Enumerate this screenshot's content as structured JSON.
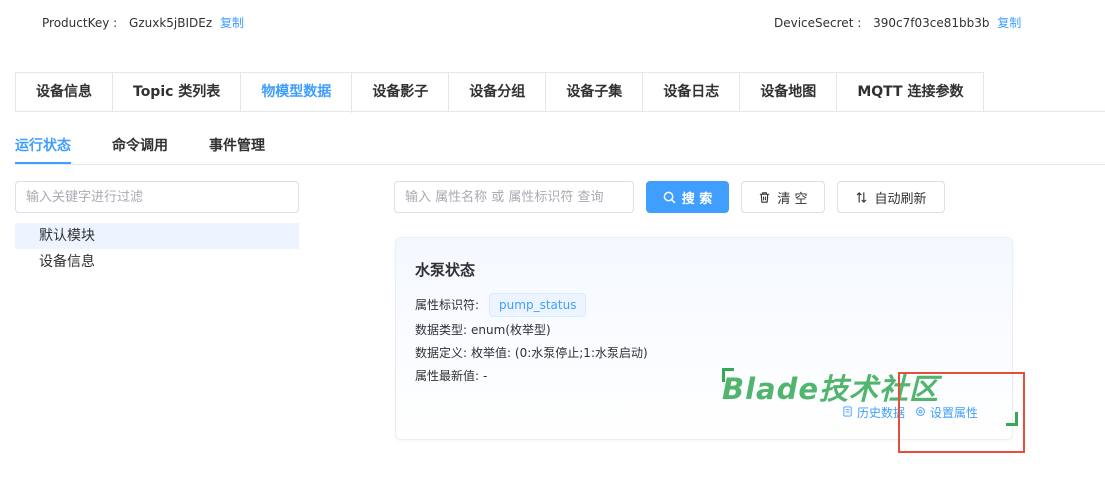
{
  "header": {
    "product_key_label": "ProductKey :",
    "product_key_value": "Gzuxk5jBIDEz",
    "product_key_copy": "复制",
    "device_secret_label": "DeviceSecret :",
    "device_secret_value": "390c7f03ce81bb3b",
    "device_secret_copy": "复制"
  },
  "tabs": [
    {
      "label": "设备信息",
      "active": false
    },
    {
      "label": "Topic 类列表",
      "active": false
    },
    {
      "label": "物模型数据",
      "active": true
    },
    {
      "label": "设备影子",
      "active": false
    },
    {
      "label": "设备分组",
      "active": false
    },
    {
      "label": "设备子集",
      "active": false
    },
    {
      "label": "设备日志",
      "active": false
    },
    {
      "label": "设备地图",
      "active": false
    },
    {
      "label": "MQTT 连接参数",
      "active": false
    }
  ],
  "subtabs": [
    {
      "label": "运行状态",
      "active": true
    },
    {
      "label": "命令调用",
      "active": false
    },
    {
      "label": "事件管理",
      "active": false
    }
  ],
  "sidebar": {
    "filter_placeholder": "输入关键字进行过滤",
    "tree": [
      {
        "label": "默认模块",
        "selected": true
      },
      {
        "label": "设备信息",
        "selected": false
      }
    ]
  },
  "toolbar": {
    "search_placeholder": "输入 属性名称 或 属性标识符 查询",
    "search_label": "搜 索",
    "clear_label": "清 空",
    "refresh_label": "自动刷新"
  },
  "property_card": {
    "title": "水泵状态",
    "identifier_label": "属性标识符:",
    "identifier_value": "pump_status",
    "data_type_label": "数据类型:",
    "data_type_value": "enum(枚举型)",
    "definition_label": "数据定义:",
    "definition_value": "枚举值: (0:水泵停止;1:水泵启动)",
    "latest_label": "属性最新值:",
    "latest_value": "-",
    "history_action": "历史数据",
    "set_action": "设置属性"
  },
  "watermark": "Blade技术社区",
  "colors": {
    "accent": "#409eff",
    "watermark": "#34a853",
    "highlight": "#e74c3c"
  }
}
